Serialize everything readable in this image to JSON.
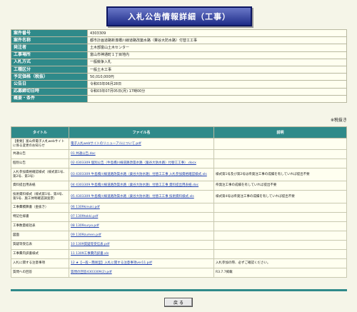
{
  "page": {
    "title": "入札公告情報詳細（工事）"
  },
  "info": [
    {
      "label": "案件番号",
      "value": "4303309"
    },
    {
      "label": "案件名称",
      "value": "都市計画道路新湊橋川線道路改築水路（粟谷大防水路）付替工工事"
    },
    {
      "label": "発注者",
      "value": "土木部富山土木センター"
    },
    {
      "label": "工事場所",
      "value": "富山市神通町１丁目地内"
    },
    {
      "label": "入札方式",
      "value": "一般競争入札"
    },
    {
      "label": "工種区分",
      "value": "一般土木工事"
    },
    {
      "label": "予定価格（税抜）",
      "value": "50,010,000円"
    },
    {
      "label": "公告日",
      "value": "令和03年06月28日"
    },
    {
      "label": "応募締切日時",
      "value": "令和03年07月05日(月) 17時00分"
    },
    {
      "label": "概要・条件",
      "value": ""
    }
  ],
  "tax_note": "※税抜き",
  "files": {
    "headers": {
      "title": "タイトル",
      "file": "ファイル名",
      "note": "説明"
    },
    "rows": [
      {
        "title": "【重要】富山県電子入札webサイトに係る変更のお知らせ",
        "file": "電子入札webサイトのリニューアルについて.pdf",
        "note": ""
      },
      {
        "title": "共通公告",
        "file": "01 共通公告.doc",
        "note": ""
      },
      {
        "title": "個別公告",
        "file": "02 4303309 個別公告（牛島橋川線道路改築水路（粟谷大防水路）付替工工事）.docx",
        "note": ""
      },
      {
        "title": "入札参加資格確認様式（様式第1号、第2号、第3号）",
        "file": "03 4303309 牛島橋川線道路改築水路（粟谷大防水路）付替工工事 入札参加資格確認様式.xls",
        "note": "様式第1号及び第2号は県発注工事の成績を有していれば提出不要"
      },
      {
        "title": "資料提出用表紙",
        "file": "04 4303309 牛島橋川線道路改築水路（粟谷大防水路）付替工工事 資料提出用表紙.doc",
        "note": "県発注工事の成績を有していれば提出不要"
      },
      {
        "title": "技術資料様式（様式第1号、第4号、第5号、施工体制確認調査票）",
        "file": "05 4303309 牛島橋川線道路改築水路（粟谷大防水路）付替工工事 技術資料様式.xls",
        "note": "様式第4号は県発注工事の成績を有していれば提出不要"
      },
      {
        "title": "工事費積算書（金抜き）",
        "file": "06 1309kinuki.pdf",
        "note": ""
      },
      {
        "title": "特記仕様書",
        "file": "07 1309tokki.pdf",
        "note": ""
      },
      {
        "title": "工事数量総括表",
        "file": "08 1309suryo.pdf",
        "note": ""
      },
      {
        "title": "図面",
        "file": "09 1309zumen.pdf",
        "note": ""
      },
      {
        "title": "質疑等受信表",
        "file": "10 1309質疑等受信表.pdf",
        "note": ""
      },
      {
        "title": "工事費内訳書様式",
        "file": "11 1309工事費内訳書.xls",
        "note": ""
      },
      {
        "title": "入札に関する注意事項",
        "file": "12 ★【一般・簡易型】入札に関する注意事項ver11.pdf",
        "note": "入札参加の際、必ずご確認ください。"
      },
      {
        "title": "質問への回答",
        "file": "質問の回答4303309(2).pdf",
        "note": "R3.7.7掲載"
      }
    ]
  },
  "footer": {
    "back_label": "戻 る"
  }
}
